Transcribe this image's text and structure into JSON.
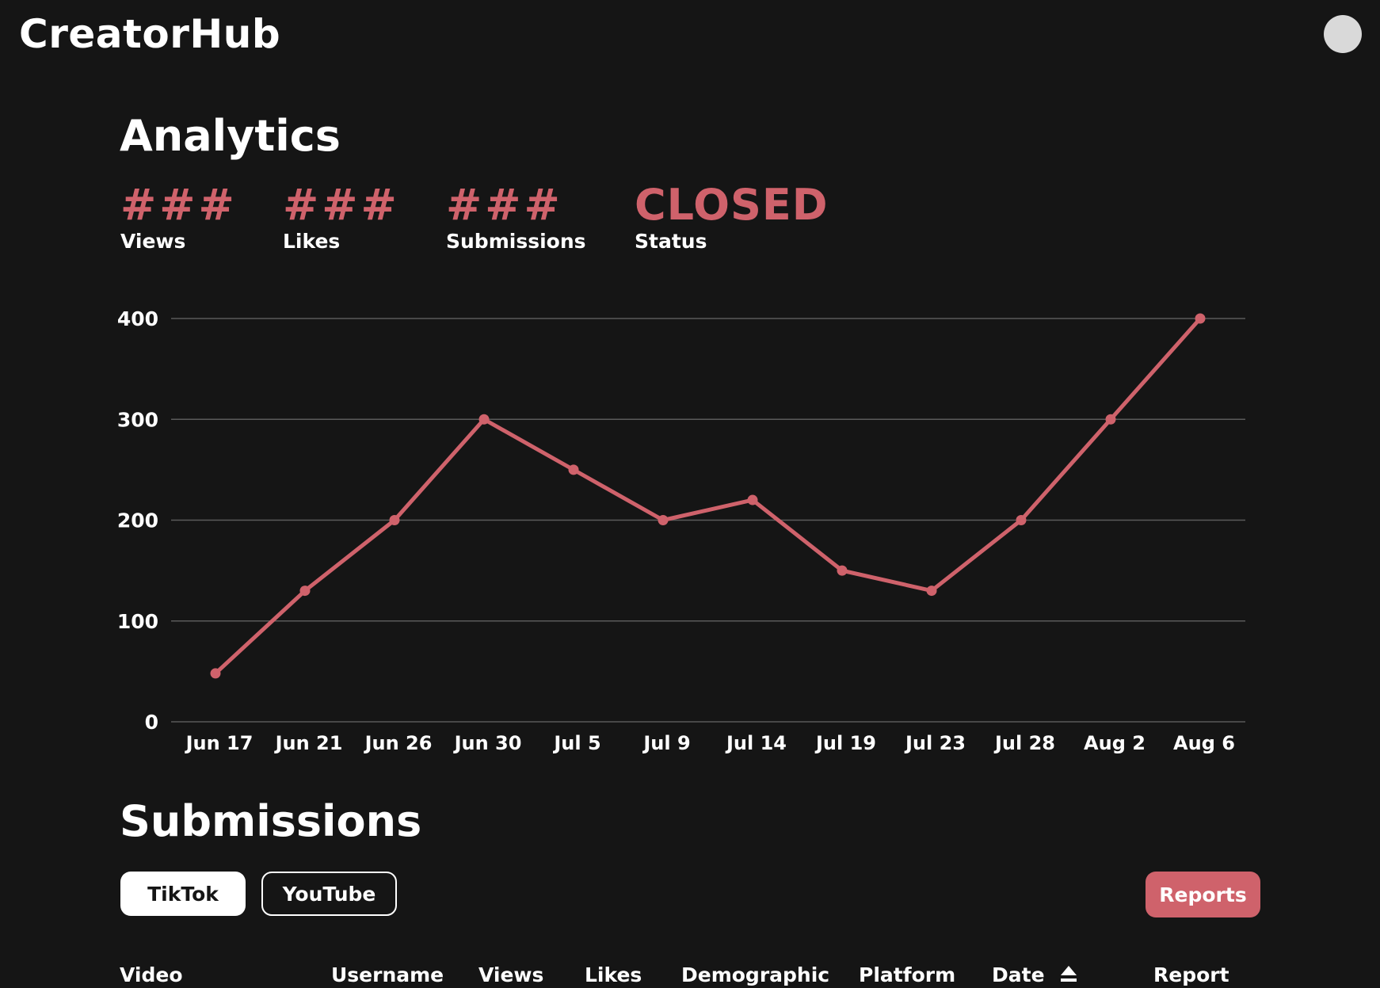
{
  "app": {
    "name": "CreatorHub"
  },
  "analytics": {
    "title": "Analytics",
    "stats": [
      {
        "value": "###",
        "label": "Views"
      },
      {
        "value": "###",
        "label": "Likes"
      },
      {
        "value": "###",
        "label": "Submissions"
      },
      {
        "value": "CLOSED",
        "label": "Status"
      }
    ]
  },
  "chart_data": {
    "type": "line",
    "categories": [
      "Jun 17",
      "Jun 21",
      "Jun 26",
      "Jun 30",
      "Jul 5",
      "Jul 9",
      "Jul 14",
      "Jul 19",
      "Jul 23",
      "Jul 28",
      "Aug 2",
      "Aug 6"
    ],
    "series": [
      {
        "values": [
          48,
          130,
          200,
          300,
          250,
          200,
          220,
          150,
          130,
          200,
          300,
          400
        ]
      }
    ],
    "yticks": [
      0,
      100,
      200,
      300,
      400
    ],
    "ylim": [
      0,
      400
    ],
    "grid": true,
    "color": "#cf626b"
  },
  "submissions": {
    "title": "Submissions",
    "tabs": [
      {
        "label": "TikTok",
        "active": true
      },
      {
        "label": "YouTube",
        "active": false
      }
    ],
    "reports_label": "Reports",
    "columns": [
      "Video",
      "Username",
      "Views",
      "Likes",
      "Demographic",
      "Platform",
      "Date",
      "Report"
    ]
  },
  "colors": {
    "accent": "#cf626b",
    "background": "#151515"
  },
  "icons": {
    "sort": "sort-arrow-icon"
  }
}
